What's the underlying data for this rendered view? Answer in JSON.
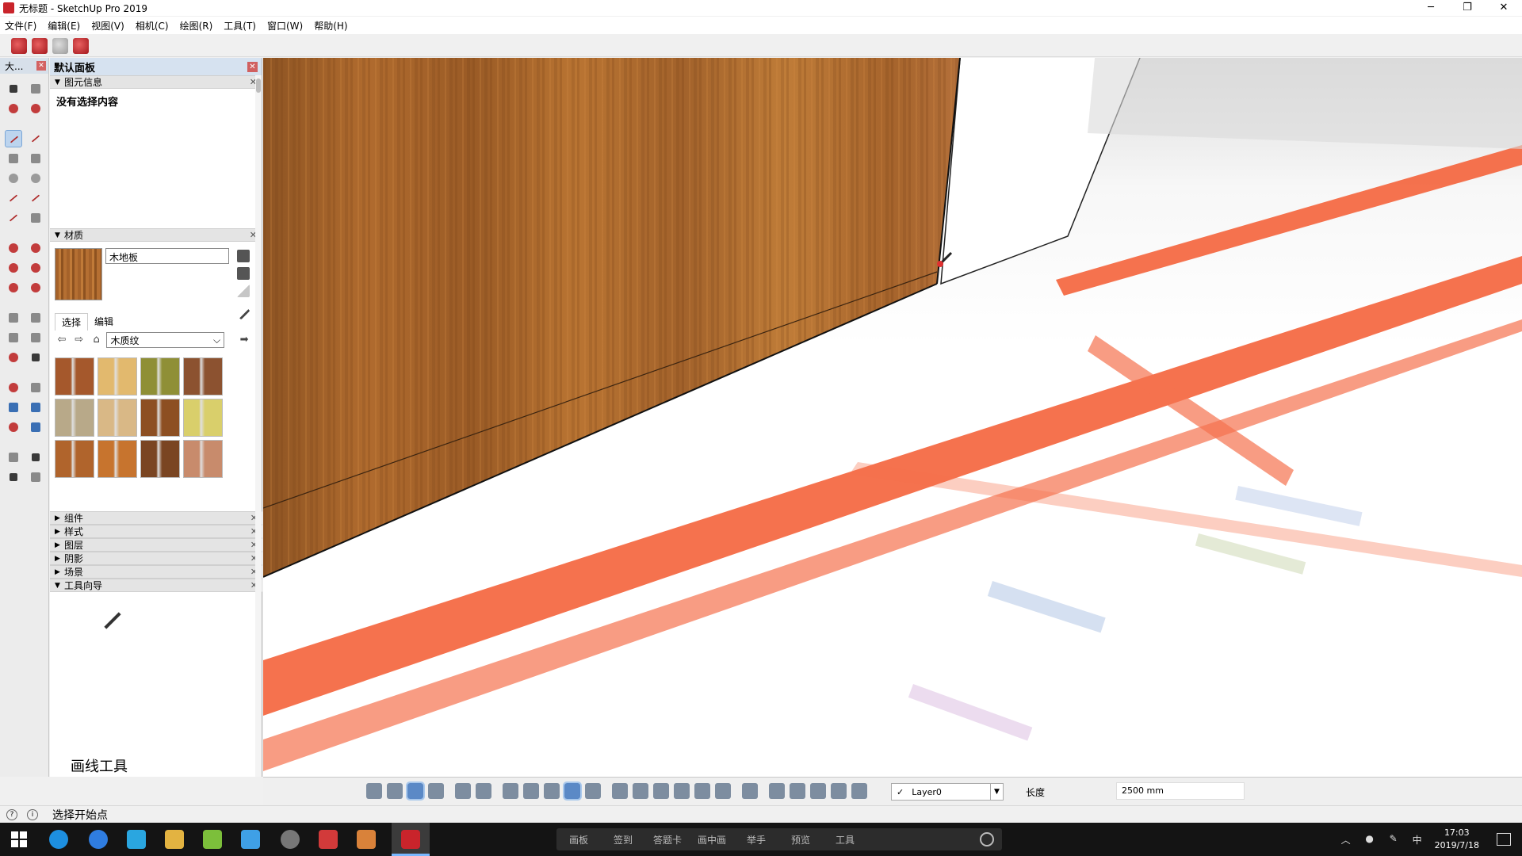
{
  "window": {
    "title": "无标题 - SketchUp Pro 2019",
    "controls": [
      "─",
      "❐",
      "✕"
    ]
  },
  "menu": [
    "文件(F)",
    "编辑(E)",
    "视图(V)",
    "相机(C)",
    "绘图(R)",
    "工具(T)",
    "窗口(W)",
    "帮助(H)"
  ],
  "tool_palette": {
    "title": "大..."
  },
  "tray": {
    "title": "默认面板",
    "entity_info": {
      "title": "图元信息",
      "empty_text": "没有选择内容"
    },
    "materials": {
      "title": "材质",
      "current_name": "木地板",
      "tabs": [
        "选择",
        "编辑"
      ],
      "library": "木质纹",
      "swatch_colors": [
        "#a5582c",
        "#e2b96e",
        "#8f8f36",
        "#8c5230",
        "#b8a989",
        "#d9b886",
        "#8d4f22",
        "#d9cf6b",
        "#b0642c",
        "#c7742e",
        "#7a4522",
        "#c88b6c"
      ]
    },
    "collapsed_sections": [
      "组件",
      "样式",
      "图层",
      "阴影",
      "场景"
    ],
    "instructor": {
      "title": "工具向导",
      "caption": "画线工具"
    }
  },
  "bottom": {
    "layer": "Layer0",
    "length_label": "长度",
    "length_value": "2500 mm"
  },
  "status": {
    "message": "选择开始点"
  },
  "taskbar": {
    "ime_items": [
      "画板",
      "签到",
      "答题卡",
      "画中画",
      "举手",
      "预览",
      "工具"
    ],
    "ime_lang": "中",
    "time": "17:03",
    "date": "2019/7/18"
  },
  "colors": {
    "accent_red": "#f4623a",
    "wood": "#a8672c",
    "panel_header": "#d6e2f0"
  }
}
